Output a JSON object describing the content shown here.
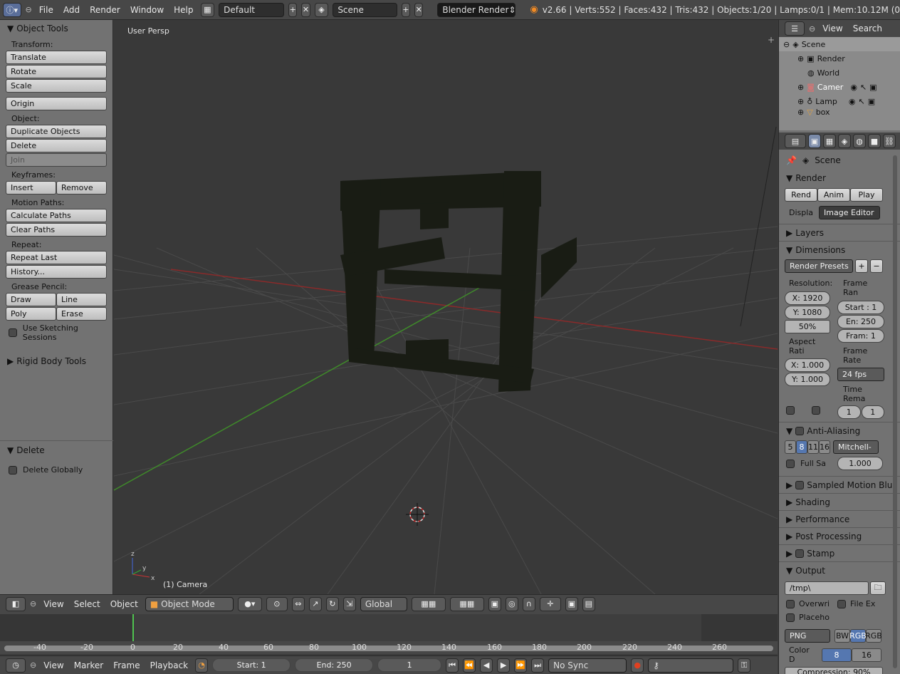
{
  "topbar": {
    "menus": [
      "File",
      "Add",
      "Render",
      "Window",
      "Help"
    ],
    "layout": "Default",
    "scene": "Scene",
    "engine": "Blender Render",
    "stats": "v2.66 | Verts:552 | Faces:432 | Tris:432 | Objects:1/20 | Lamps:0/1 | Mem:10.12M (0"
  },
  "tools": {
    "title": "Object Tools",
    "transform_label": "Transform:",
    "translate": "Translate",
    "rotate": "Rotate",
    "scale": "Scale",
    "origin": "Origin",
    "object_label": "Object:",
    "duplicate": "Duplicate Objects",
    "delete": "Delete",
    "join": "Join",
    "keyframes_label": "Keyframes:",
    "insert": "Insert",
    "remove": "Remove",
    "motion_label": "Motion Paths:",
    "calc_paths": "Calculate Paths",
    "clear_paths": "Clear Paths",
    "repeat_label": "Repeat:",
    "repeat_last": "Repeat Last",
    "history": "History...",
    "grease_label": "Grease Pencil:",
    "draw": "Draw",
    "line": "Line",
    "poly": "Poly",
    "erase": "Erase",
    "sketching": "Use Sketching Sessions",
    "rigid": "Rigid Body Tools",
    "delete_panel": "Delete",
    "delete_globally": "Delete Globally"
  },
  "viewport": {
    "title": "User Persp",
    "object": "(1) Camera"
  },
  "vpfoot": {
    "view": "View",
    "select": "Select",
    "object": "Object",
    "mode": "Object Mode",
    "orientation": "Global"
  },
  "timeline": {
    "ticks": [
      "-40",
      "-20",
      "0",
      "20",
      "40",
      "60",
      "80",
      "100",
      "120",
      "140",
      "160",
      "180",
      "200",
      "220",
      "240",
      "260"
    ]
  },
  "tlfoot": {
    "view": "View",
    "marker": "Marker",
    "frame": "Frame",
    "playback": "Playback",
    "start": "Start: 1",
    "end": "End: 250",
    "current": "1",
    "sync": "No Sync"
  },
  "outliner": {
    "view": "View",
    "search": "Search",
    "items": [
      "Scene",
      "Render",
      "World",
      "Camer",
      "Lamp",
      "box"
    ]
  },
  "props": {
    "scene": "Scene",
    "render": "Render",
    "rend": "Rend",
    "anim": "Anim",
    "play": "Play",
    "display_label": "Displa",
    "display_value": "Image Editor",
    "layers": "Layers",
    "dimensions": "Dimensions",
    "presets": "Render Presets",
    "resolution": "Resolution:",
    "res_x": "X: 1920",
    "res_y": "Y: 1080",
    "res_pct": "50%",
    "frame_range": "Frame Ran",
    "start": "Start : 1",
    "end": "En: 250",
    "frame": "Fram: 1",
    "aspect": "Aspect Rati",
    "asp_x": "X: 1.000",
    "asp_y": "Y: 1.000",
    "frame_rate": "Frame Rate",
    "fps": "24 fps",
    "time_remap": "Time Rema",
    "remap_old": "1",
    "remap_new": "1",
    "anti_aliasing": "Anti-Aliasing",
    "aa_samples": [
      "5",
      "8",
      "11",
      "16"
    ],
    "aa_filter": "Mitchell-",
    "full_sample": "Full Sa",
    "filter_size": "1.000",
    "motion_blur": "Sampled Motion Blu",
    "shading": "Shading",
    "performance": "Performance",
    "post": "Post Processing",
    "stamp": "Stamp",
    "output": "Output",
    "path": "/tmp\\",
    "overwrite": "Overwri",
    "file_ext": "File Ex",
    "placeholder": "Placeho",
    "format": "PNG",
    "bw": "BW",
    "rgb": "RGB",
    "rgba": "RGB",
    "color_depth": "Color D",
    "depth8": "8",
    "depth16": "16",
    "compression": "Compression: 90%"
  }
}
